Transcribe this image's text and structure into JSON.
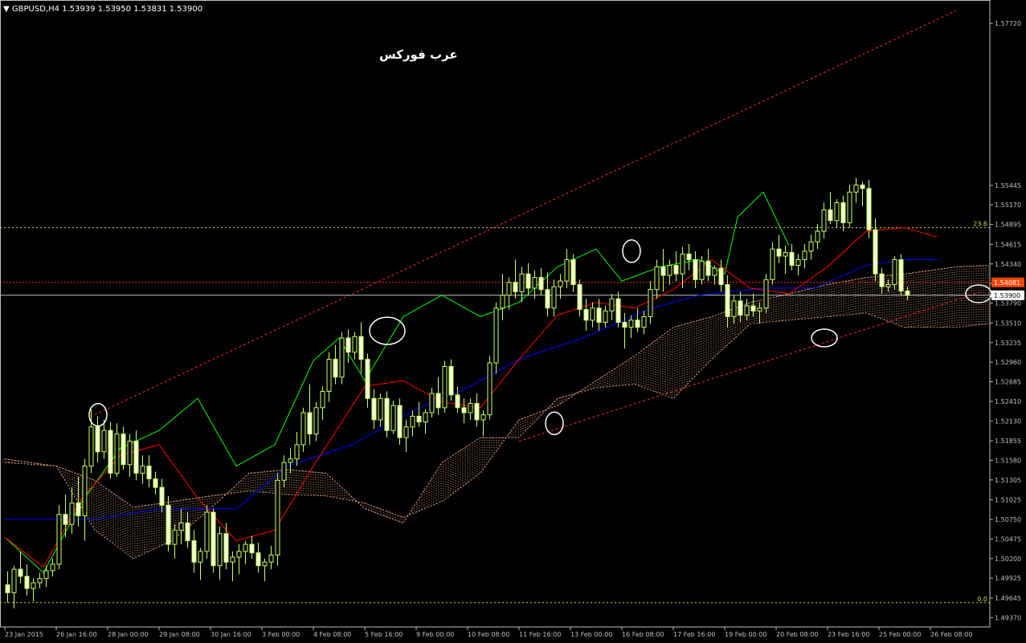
{
  "header": {
    "symbol_line": "GBPUSD,H4  1.53939 1.53950 1.53831 1.53900"
  },
  "watermark": "عرب فوركس",
  "colors": {
    "background": "#000000",
    "axis": "#c0c0c0",
    "candle": "#ccff66",
    "chikou": "#00ff00",
    "tenkan": "#ff0000",
    "kijun": "#0000ff",
    "cloud": "#d9a27a",
    "fib": "#d8d84a",
    "trend": "#ff2a2a",
    "bid_line": "#c0c0c0",
    "red_price_tag": "#ff4500"
  },
  "chart_data": {
    "type": "candlestick",
    "symbol": "GBPUSD",
    "timeframe": "H4",
    "ohlc_header": {
      "open": 1.53939,
      "high": 1.5395,
      "low": 1.53831,
      "close": 1.539
    },
    "y_axis": {
      "ylim": [
        1.49329,
        1.5788
      ],
      "ticks": [
        "1.57720",
        "1.55445",
        "1.55170",
        "1.54895",
        "1.54615",
        "1.54340",
        "1.54065",
        "1.53790",
        "1.53510",
        "1.53235",
        "1.52960",
        "1.52685",
        "1.52410",
        "1.52130",
        "1.51855",
        "1.51580",
        "1.51305",
        "1.51025",
        "1.50750",
        "1.50475",
        "1.50200",
        "1.49925",
        "1.49645",
        "1.49370"
      ],
      "price_tags": [
        {
          "label": "1.54081",
          "value": 1.54081,
          "style": "red"
        },
        {
          "label": "1.53900",
          "value": 1.539,
          "style": "bid"
        }
      ]
    },
    "x_axis": {
      "labels": [
        "23 Jan 2015",
        "26 Jan 16:00",
        "28 Jan 00:00",
        "29 Jan 08:00",
        "30 Jan 16:00",
        "3 Feb 00:00",
        "4 Feb 08:00",
        "5 Feb 16:00",
        "9 Feb 00:00",
        "10 Feb 08:00",
        "11 Feb 16:00",
        "13 Feb 00:00",
        "16 Feb 08:00",
        "17 Feb 16:00",
        "19 Feb 00:00",
        "20 Feb 08:00",
        "23 Feb 16:00",
        "25 Feb 00:00",
        "26 Feb 08:00"
      ],
      "bars_per_label": 8
    },
    "fibonacci": [
      {
        "label": "23.6",
        "value": 1.5485
      },
      {
        "label": "0.0",
        "value": 1.4958
      }
    ],
    "candles": [
      [
        1.4983,
        1.5002,
        1.4958,
        1.4972
      ],
      [
        1.4972,
        1.501,
        1.495,
        1.5005
      ],
      [
        1.5005,
        1.503,
        1.4985,
        1.4995
      ],
      [
        1.4995,
        1.5012,
        1.4968,
        1.4978
      ],
      [
        1.4978,
        1.4992,
        1.496,
        1.4986
      ],
      [
        1.4986,
        1.5,
        1.4978,
        1.4992
      ],
      [
        1.4992,
        1.501,
        1.498,
        1.5003
      ],
      [
        1.5003,
        1.502,
        1.4995,
        1.5012
      ],
      [
        1.5012,
        1.5095,
        1.5005,
        1.5082
      ],
      [
        1.5082,
        1.511,
        1.505,
        1.5068
      ],
      [
        1.5068,
        1.512,
        1.5055,
        1.5098
      ],
      [
        1.5098,
        1.5135,
        1.5065,
        1.508
      ],
      [
        1.508,
        1.516,
        1.5045,
        1.515
      ],
      [
        1.515,
        1.523,
        1.514,
        1.5205
      ],
      [
        1.5205,
        1.522,
        1.5155,
        1.517
      ],
      [
        1.517,
        1.5215,
        1.516,
        1.52
      ],
      [
        1.52,
        1.5212,
        1.5132,
        1.514
      ],
      [
        1.514,
        1.521,
        1.5135,
        1.5195
      ],
      [
        1.5195,
        1.5205,
        1.5145,
        1.5152
      ],
      [
        1.5152,
        1.5195,
        1.5135,
        1.5185
      ],
      [
        1.5185,
        1.52,
        1.513,
        1.514
      ],
      [
        1.514,
        1.5165,
        1.5125,
        1.515
      ],
      [
        1.515,
        1.5165,
        1.512,
        1.5132
      ],
      [
        1.5132,
        1.5142,
        1.511,
        1.512
      ],
      [
        1.512,
        1.5132,
        1.5085,
        1.5095
      ],
      [
        1.5095,
        1.5108,
        1.503,
        1.504
      ],
      [
        1.504,
        1.5068,
        1.502,
        1.506
      ],
      [
        1.506,
        1.509,
        1.504,
        1.507
      ],
      [
        1.507,
        1.5085,
        1.5035,
        1.5045
      ],
      [
        1.5045,
        1.506,
        1.5,
        1.5015
      ],
      [
        1.5015,
        1.5035,
        1.499,
        1.503
      ],
      [
        1.503,
        1.5095,
        1.502,
        1.5085
      ],
      [
        1.5085,
        1.509,
        1.5,
        1.501
      ],
      [
        1.501,
        1.5065,
        1.499,
        1.5055
      ],
      [
        1.5055,
        1.507,
        1.5005,
        1.5015
      ],
      [
        1.5015,
        1.503,
        1.4988,
        1.5022
      ],
      [
        1.5022,
        1.504,
        1.4998,
        1.503
      ],
      [
        1.503,
        1.5045,
        1.5012,
        1.504
      ],
      [
        1.504,
        1.5052,
        1.502,
        1.5028
      ],
      [
        1.5028,
        1.5042,
        1.5,
        1.501
      ],
      [
        1.501,
        1.502,
        1.4988,
        1.5015
      ],
      [
        1.5015,
        1.5038,
        1.5005,
        1.5025
      ],
      [
        1.5025,
        1.514,
        1.501,
        1.513
      ],
      [
        1.513,
        1.5165,
        1.512,
        1.5155
      ],
      [
        1.5155,
        1.5175,
        1.514,
        1.516
      ],
      [
        1.516,
        1.5198,
        1.515,
        1.518
      ],
      [
        1.518,
        1.5232,
        1.517,
        1.5225
      ],
      [
        1.5225,
        1.5265,
        1.518,
        1.5195
      ],
      [
        1.5195,
        1.524,
        1.5185,
        1.5232
      ],
      [
        1.5232,
        1.5262,
        1.5215,
        1.5255
      ],
      [
        1.5255,
        1.531,
        1.524,
        1.53
      ],
      [
        1.53,
        1.532,
        1.5265,
        1.5275
      ],
      [
        1.5275,
        1.5338,
        1.5265,
        1.533
      ],
      [
        1.533,
        1.5342,
        1.5295,
        1.531
      ],
      [
        1.531,
        1.5338,
        1.53,
        1.5332
      ],
      [
        1.5332,
        1.5352,
        1.528,
        1.53
      ],
      [
        1.53,
        1.5308,
        1.5232,
        1.5245
      ],
      [
        1.5245,
        1.5258,
        1.5202,
        1.5215
      ],
      [
        1.5215,
        1.5252,
        1.5205,
        1.5245
      ],
      [
        1.5245,
        1.5255,
        1.519,
        1.52
      ],
      [
        1.52,
        1.5242,
        1.5195,
        1.5235
      ],
      [
        1.5235,
        1.5245,
        1.518,
        1.519
      ],
      [
        1.519,
        1.5215,
        1.517,
        1.5205
      ],
      [
        1.5205,
        1.5228,
        1.5192,
        1.522
      ],
      [
        1.522,
        1.524,
        1.5205,
        1.5212
      ],
      [
        1.5212,
        1.523,
        1.5195,
        1.5225
      ],
      [
        1.5225,
        1.526,
        1.5218,
        1.5252
      ],
      [
        1.5252,
        1.5275,
        1.5222,
        1.5232
      ],
      [
        1.5232,
        1.5298,
        1.5225,
        1.529
      ],
      [
        1.529,
        1.53,
        1.5242,
        1.525
      ],
      [
        1.525,
        1.5262,
        1.5225,
        1.5232
      ],
      [
        1.5232,
        1.5245,
        1.521,
        1.5225
      ],
      [
        1.5225,
        1.5245,
        1.5215,
        1.5238
      ],
      [
        1.5238,
        1.5252,
        1.5205,
        1.5215
      ],
      [
        1.5215,
        1.5228,
        1.5192,
        1.5222
      ],
      [
        1.5222,
        1.5305,
        1.5215,
        1.5295
      ],
      [
        1.5295,
        1.538,
        1.528,
        1.5372
      ],
      [
        1.5372,
        1.542,
        1.5355,
        1.539
      ],
      [
        1.539,
        1.5415,
        1.537,
        1.5408
      ],
      [
        1.5408,
        1.544,
        1.5385,
        1.5395
      ],
      [
        1.5395,
        1.543,
        1.538,
        1.542
      ],
      [
        1.542,
        1.5435,
        1.539,
        1.54
      ],
      [
        1.54,
        1.5425,
        1.5385,
        1.5415
      ],
      [
        1.5415,
        1.5428,
        1.539,
        1.5398
      ],
      [
        1.5398,
        1.5422,
        1.536,
        1.5372
      ],
      [
        1.5372,
        1.5412,
        1.536,
        1.5402
      ],
      [
        1.5402,
        1.542,
        1.5385,
        1.541
      ],
      [
        1.541,
        1.5455,
        1.54,
        1.544
      ],
      [
        1.544,
        1.5448,
        1.5395,
        1.5405
      ],
      [
        1.5405,
        1.5412,
        1.536,
        1.537
      ],
      [
        1.537,
        1.5385,
        1.534,
        1.5355
      ],
      [
        1.5355,
        1.538,
        1.5345,
        1.5372
      ],
      [
        1.5372,
        1.5385,
        1.534,
        1.5352
      ],
      [
        1.5352,
        1.5375,
        1.5345,
        1.5368
      ],
      [
        1.5368,
        1.5392,
        1.5355,
        1.5385
      ],
      [
        1.5385,
        1.5395,
        1.5345,
        1.5352
      ],
      [
        1.5352,
        1.5365,
        1.5315,
        1.5345
      ],
      [
        1.5345,
        1.5362,
        1.533,
        1.5355
      ],
      [
        1.5355,
        1.5372,
        1.5338,
        1.5345
      ],
      [
        1.5345,
        1.5368,
        1.5335,
        1.536
      ],
      [
        1.536,
        1.541,
        1.535,
        1.5398
      ],
      [
        1.5398,
        1.544,
        1.5385,
        1.543
      ],
      [
        1.543,
        1.5455,
        1.5395,
        1.5418
      ],
      [
        1.5418,
        1.544,
        1.5405,
        1.5432
      ],
      [
        1.5432,
        1.5452,
        1.541,
        1.542
      ],
      [
        1.542,
        1.5458,
        1.54,
        1.5448
      ],
      [
        1.5448,
        1.5462,
        1.5425,
        1.544
      ],
      [
        1.544,
        1.5452,
        1.54,
        1.5412
      ],
      [
        1.5412,
        1.5445,
        1.5405,
        1.5438
      ],
      [
        1.5438,
        1.5455,
        1.541,
        1.5418
      ],
      [
        1.5418,
        1.5432,
        1.5405,
        1.5428
      ],
      [
        1.5428,
        1.544,
        1.5395,
        1.5405
      ],
      [
        1.5405,
        1.5418,
        1.5345,
        1.536
      ],
      [
        1.536,
        1.539,
        1.535,
        1.5382
      ],
      [
        1.5382,
        1.5395,
        1.5352,
        1.5362
      ],
      [
        1.5362,
        1.5385,
        1.5355,
        1.5375
      ],
      [
        1.5375,
        1.5392,
        1.536,
        1.5368
      ],
      [
        1.5368,
        1.538,
        1.535,
        1.5372
      ],
      [
        1.5372,
        1.542,
        1.5365,
        1.5412
      ],
      [
        1.5412,
        1.5465,
        1.5405,
        1.5455
      ],
      [
        1.5455,
        1.5475,
        1.5435,
        1.5445
      ],
      [
        1.5445,
        1.546,
        1.542,
        1.545
      ],
      [
        1.545,
        1.5462,
        1.5425,
        1.5432
      ],
      [
        1.5432,
        1.5448,
        1.5418,
        1.544
      ],
      [
        1.544,
        1.5462,
        1.5428,
        1.5452
      ],
      [
        1.5452,
        1.5475,
        1.544,
        1.5465
      ],
      [
        1.5465,
        1.549,
        1.5455,
        1.548
      ],
      [
        1.548,
        1.552,
        1.547,
        1.551
      ],
      [
        1.551,
        1.5535,
        1.549,
        1.5495
      ],
      [
        1.5495,
        1.5525,
        1.5485,
        1.552
      ],
      [
        1.552,
        1.553,
        1.548,
        1.5492
      ],
      [
        1.5492,
        1.5545,
        1.5485,
        1.5535
      ],
      [
        1.5535,
        1.5555,
        1.552,
        1.5545
      ],
      [
        1.5545,
        1.555,
        1.5515,
        1.554
      ],
      [
        1.554,
        1.5552,
        1.547,
        1.5482
      ],
      [
        1.5482,
        1.5498,
        1.541,
        1.542
      ],
      [
        1.542,
        1.5428,
        1.5392,
        1.5402
      ],
      [
        1.5402,
        1.5412,
        1.5395,
        1.5405
      ],
      [
        1.5405,
        1.5445,
        1.5398,
        1.544
      ],
      [
        1.544,
        1.5448,
        1.539,
        1.5396
      ],
      [
        1.5396,
        1.5402,
        1.5383,
        1.539
      ]
    ],
    "tenkan_sen": [
      [
        0,
        1.505
      ],
      [
        6,
        1.5008
      ],
      [
        12,
        1.5105
      ],
      [
        18,
        1.5165
      ],
      [
        24,
        1.518
      ],
      [
        30,
        1.5105
      ],
      [
        36,
        1.5045
      ],
      [
        42,
        1.506
      ],
      [
        48,
        1.515
      ],
      [
        56,
        1.5262
      ],
      [
        62,
        1.527
      ],
      [
        68,
        1.524
      ],
      [
        74,
        1.5232
      ],
      [
        80,
        1.53
      ],
      [
        86,
        1.5362
      ],
      [
        92,
        1.538
      ],
      [
        98,
        1.5372
      ],
      [
        104,
        1.5398
      ],
      [
        110,
        1.544
      ],
      [
        116,
        1.54
      ],
      [
        122,
        1.5392
      ],
      [
        128,
        1.543
      ],
      [
        134,
        1.548
      ],
      [
        140,
        1.5485
      ],
      [
        145,
        1.5472
      ]
    ],
    "kijun_sen": [
      [
        0,
        1.5075
      ],
      [
        14,
        1.5075
      ],
      [
        24,
        1.509
      ],
      [
        36,
        1.509
      ],
      [
        44,
        1.515
      ],
      [
        54,
        1.518
      ],
      [
        64,
        1.523
      ],
      [
        72,
        1.526
      ],
      [
        80,
        1.53
      ],
      [
        90,
        1.533
      ],
      [
        100,
        1.537
      ],
      [
        108,
        1.539
      ],
      [
        118,
        1.54
      ],
      [
        126,
        1.54
      ],
      [
        134,
        1.5432
      ],
      [
        140,
        1.544
      ],
      [
        145,
        1.544
      ]
    ],
    "chikou_span": [
      [
        0,
        1.505
      ],
      [
        6,
        1.5
      ],
      [
        12,
        1.51
      ],
      [
        18,
        1.5175
      ],
      [
        24,
        1.52
      ],
      [
        30,
        1.5245
      ],
      [
        36,
        1.515
      ],
      [
        42,
        1.518
      ],
      [
        48,
        1.5298
      ],
      [
        52,
        1.533
      ],
      [
        56,
        1.527
      ],
      [
        62,
        1.536
      ],
      [
        68,
        1.539
      ],
      [
        74,
        1.536
      ],
      [
        80,
        1.538
      ],
      [
        86,
        1.543
      ],
      [
        92,
        1.5455
      ],
      [
        96,
        1.541
      ],
      [
        102,
        1.543
      ],
      [
        108,
        1.544
      ],
      [
        112,
        1.542
      ],
      [
        114,
        1.55
      ],
      [
        118,
        1.5535
      ],
      [
        122,
        1.546
      ]
    ],
    "cloud": {
      "span_a": [
        [
          0,
          1.5155
        ],
        [
          8,
          1.515
        ],
        [
          14,
          1.513
        ],
        [
          20,
          1.5092
        ],
        [
          26,
          1.51
        ],
        [
          32,
          1.5108
        ],
        [
          38,
          1.5115
        ],
        [
          44,
          1.511
        ],
        [
          50,
          1.5108
        ],
        [
          56,
          1.5098
        ],
        [
          62,
          1.5078
        ],
        [
          68,
          1.51
        ],
        [
          74,
          1.514
        ],
        [
          80,
          1.5215
        ],
        [
          86,
          1.5235
        ],
        [
          92,
          1.527
        ],
        [
          98,
          1.5305
        ],
        [
          104,
          1.5345
        ],
        [
          110,
          1.536
        ],
        [
          116,
          1.538
        ],
        [
          122,
          1.5392
        ],
        [
          128,
          1.5405
        ],
        [
          134,
          1.5415
        ],
        [
          140,
          1.542
        ],
        [
          148,
          1.543
        ],
        [
          153,
          1.5432
        ]
      ],
      "span_b": [
        [
          0,
          1.516
        ],
        [
          8,
          1.515
        ],
        [
          14,
          1.506
        ],
        [
          20,
          1.502
        ],
        [
          26,
          1.5045
        ],
        [
          32,
          1.509
        ],
        [
          38,
          1.514
        ],
        [
          44,
          1.5145
        ],
        [
          50,
          1.514
        ],
        [
          56,
          1.509
        ],
        [
          62,
          1.507
        ],
        [
          68,
          1.5155
        ],
        [
          74,
          1.519
        ],
        [
          80,
          1.519
        ],
        [
          86,
          1.5245
        ],
        [
          92,
          1.526
        ],
        [
          98,
          1.5265
        ],
        [
          104,
          1.5245
        ],
        [
          110,
          1.53
        ],
        [
          116,
          1.535
        ],
        [
          122,
          1.5355
        ],
        [
          128,
          1.536
        ],
        [
          134,
          1.5365
        ],
        [
          140,
          1.5345
        ],
        [
          148,
          1.5345
        ],
        [
          153,
          1.535
        ]
      ]
    },
    "trendlines": [
      {
        "from": [
          14,
          1.5222
        ],
        "to": [
          148,
          1.579
        ]
      },
      {
        "from": [
          80,
          1.5185
        ],
        "to": [
          152,
          1.5395
        ]
      }
    ],
    "annotations": [
      {
        "shape": "ellipse",
        "at": [
          14,
          1.5222
        ]
      },
      {
        "shape": "ellipse",
        "at": [
          59,
          1.534
        ]
      },
      {
        "shape": "ellipse",
        "at": [
          85,
          1.521
        ]
      },
      {
        "shape": "ellipse",
        "at": [
          97,
          1.5452
        ]
      },
      {
        "shape": "ellipse",
        "at": [
          127,
          1.533
        ]
      },
      {
        "shape": "ellipse",
        "at": [
          151,
          1.5392
        ]
      }
    ]
  }
}
